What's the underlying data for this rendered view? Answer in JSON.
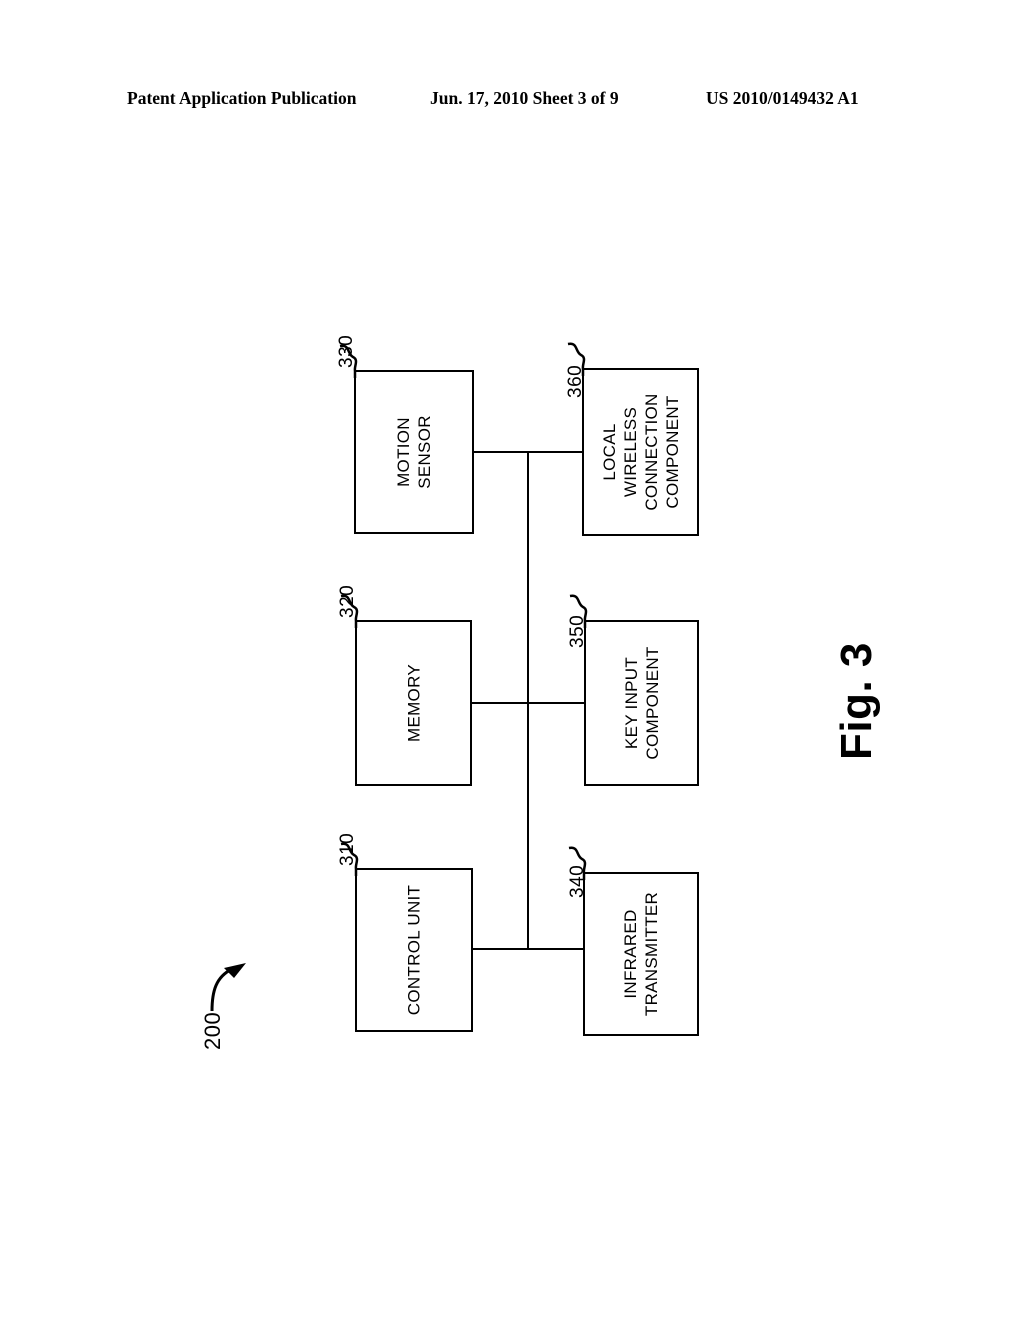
{
  "header": {
    "left": "Patent Application Publication",
    "middle": "Jun. 17, 2010  Sheet 3 of 9",
    "right": "US 2010/0149432 A1"
  },
  "figure": {
    "caption": "Fig. 3",
    "system_ref": "200",
    "blocks": [
      {
        "id": "motion-sensor",
        "label": "MOTION\nSENSOR",
        "ref": "330"
      },
      {
        "id": "local-wireless",
        "label": "LOCAL\nWIRELESS\nCONNECTION\nCOMPONENT",
        "ref": "360"
      },
      {
        "id": "memory",
        "label": "MEMORY",
        "ref": "320"
      },
      {
        "id": "key-input",
        "label": "KEY INPUT\nCOMPONENT",
        "ref": "350"
      },
      {
        "id": "control-unit",
        "label": "CONTROL UNIT",
        "ref": "310"
      },
      {
        "id": "infrared-tx",
        "label": "INFRARED\nTRANSMITTER",
        "ref": "340"
      }
    ]
  },
  "colors": {
    "ink": "#000000",
    "paper": "#ffffff"
  }
}
